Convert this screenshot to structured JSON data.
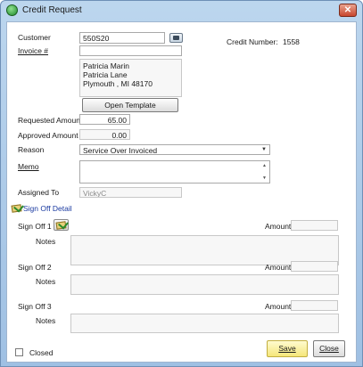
{
  "window": {
    "title": "Credit Request",
    "close_glyph": "✕"
  },
  "form": {
    "customer_label": "Customer",
    "customer_value": "550S20",
    "invoice_label": "Invoice #",
    "invoice_value": "",
    "credit_number_label": "Credit Number:",
    "credit_number_value": "1558",
    "address_lines": [
      "Patricia Marin",
      "Patricia Lane",
      "Plymouth , MI  48170"
    ],
    "open_template_label": "Open Template",
    "requested_amount_label": "Requested Amount",
    "requested_amount_value": "65.00",
    "approved_amount_label": "Approved Amount",
    "approved_amount_value": "0.00",
    "reason_label": "Reason",
    "reason_value": "Service Over Invoiced",
    "memo_label": "Memo",
    "memo_value": "",
    "assigned_to_label": "Assigned To",
    "assigned_to_value": "VickyC"
  },
  "signoff": {
    "detail_label": "Sign Off Detail",
    "rows": [
      {
        "label": "Sign Off 1",
        "amount_label": "Amount",
        "notes_label": "Notes"
      },
      {
        "label": "Sign Off 2",
        "amount_label": "Amount",
        "notes_label": "Notes"
      },
      {
        "label": "Sign Off 3",
        "amount_label": "Amount",
        "notes_label": "Notes"
      }
    ]
  },
  "footer": {
    "closed_label": "Closed",
    "save_label": "Save",
    "close_label": "Close"
  }
}
